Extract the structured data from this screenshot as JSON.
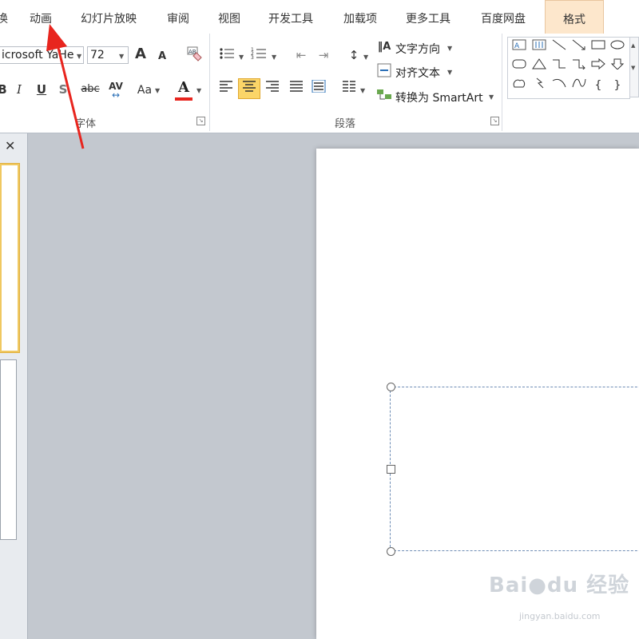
{
  "tabs": [
    {
      "label": "动画"
    },
    {
      "label": "幻灯片放映"
    },
    {
      "label": "审阅"
    },
    {
      "label": "视图"
    },
    {
      "label": "开发工具"
    },
    {
      "label": "加载项"
    },
    {
      "label": "更多工具"
    },
    {
      "label": "百度网盘"
    },
    {
      "label": "格式"
    }
  ],
  "tab_left_fragment": "换",
  "font_group": {
    "label": "字体",
    "font_name": "icrosoft YaHe",
    "font_size": "72",
    "grow_font": "A",
    "shrink_font": "A",
    "italic": "I",
    "underline": "U",
    "shadow": "S",
    "strikethrough": "abc",
    "char_spacing": "AV",
    "change_case": "Aa",
    "font_color": "A"
  },
  "paragraph_group": {
    "label": "段落",
    "text_direction": "文字方向",
    "align_text": "对齐文本",
    "convert_smartart": "转换为 SmartArt"
  },
  "left_panel": {
    "close_glyph": "✕"
  },
  "watermark": {
    "brand": "Bai●du 经验",
    "url": "jingyan.baidu.com"
  },
  "colors": {
    "accent_tab": "#fde7cc",
    "active_button": "#fbd568",
    "arrow": "#e8251e",
    "placeholder_border": "#6f8db5"
  }
}
